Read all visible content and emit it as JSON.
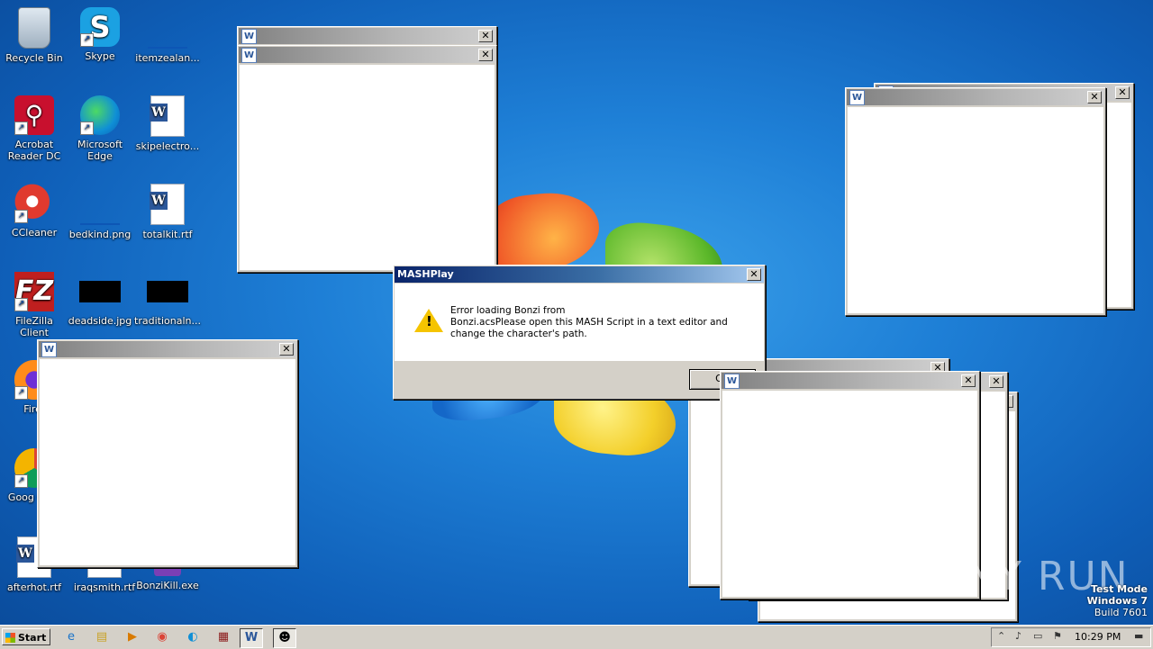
{
  "desktop": {
    "icons": [
      {
        "label": "Recycle Bin",
        "icon": "recycle-bin-icon"
      },
      {
        "label": "Skype",
        "icon": "skype-icon"
      },
      {
        "label": "itemzealan...",
        "icon": "image-file-icon"
      },
      {
        "label": "Acrobat Reader DC",
        "icon": "acrobat-icon"
      },
      {
        "label": "Microsoft Edge",
        "icon": "edge-icon"
      },
      {
        "label": "skipelectro...",
        "icon": "word-doc-icon"
      },
      {
        "label": "CCleaner",
        "icon": "ccleaner-icon"
      },
      {
        "label": "bedkind.png",
        "icon": "image-file-icon"
      },
      {
        "label": "totalkit.rtf",
        "icon": "word-doc-icon"
      },
      {
        "label": "FileZilla Client",
        "icon": "filezilla-icon"
      },
      {
        "label": "deadside.jpg",
        "icon": "image-file-icon"
      },
      {
        "label": "traditionaln...",
        "icon": "image-file-icon"
      },
      {
        "label": "Firef",
        "icon": "firefox-icon"
      },
      {
        "label": "Goog Chro",
        "icon": "chrome-icon"
      },
      {
        "label": "afterhot.rtf",
        "icon": "word-doc-icon"
      },
      {
        "label": "iraqsmith.rtf",
        "icon": "word-doc-icon"
      },
      {
        "label": "BonziKill.exe",
        "icon": "exe-icon"
      }
    ]
  },
  "dialog": {
    "title": "MASHPlay",
    "line1": "Error loading Bonzi from",
    "line2": "Bonzi.acsPlease open this MASH Script in a text editor and change the character's path.",
    "ok_label": "OK",
    "icon": "warning-icon"
  },
  "taskbar": {
    "start_label": "Start",
    "clock": "10:29 PM",
    "items": [
      "ie-icon",
      "explorer-icon",
      "media-player-icon",
      "chrome-icon",
      "edge-icon",
      "winrar-icon",
      "word-icon",
      "mashplay-icon"
    ]
  },
  "watermark": {
    "test_mode": "Test Mode",
    "os": "Windows 7",
    "build": "Build 7601",
    "brand": "ANY RUN"
  },
  "windows": {
    "close_symbol": "✕"
  }
}
